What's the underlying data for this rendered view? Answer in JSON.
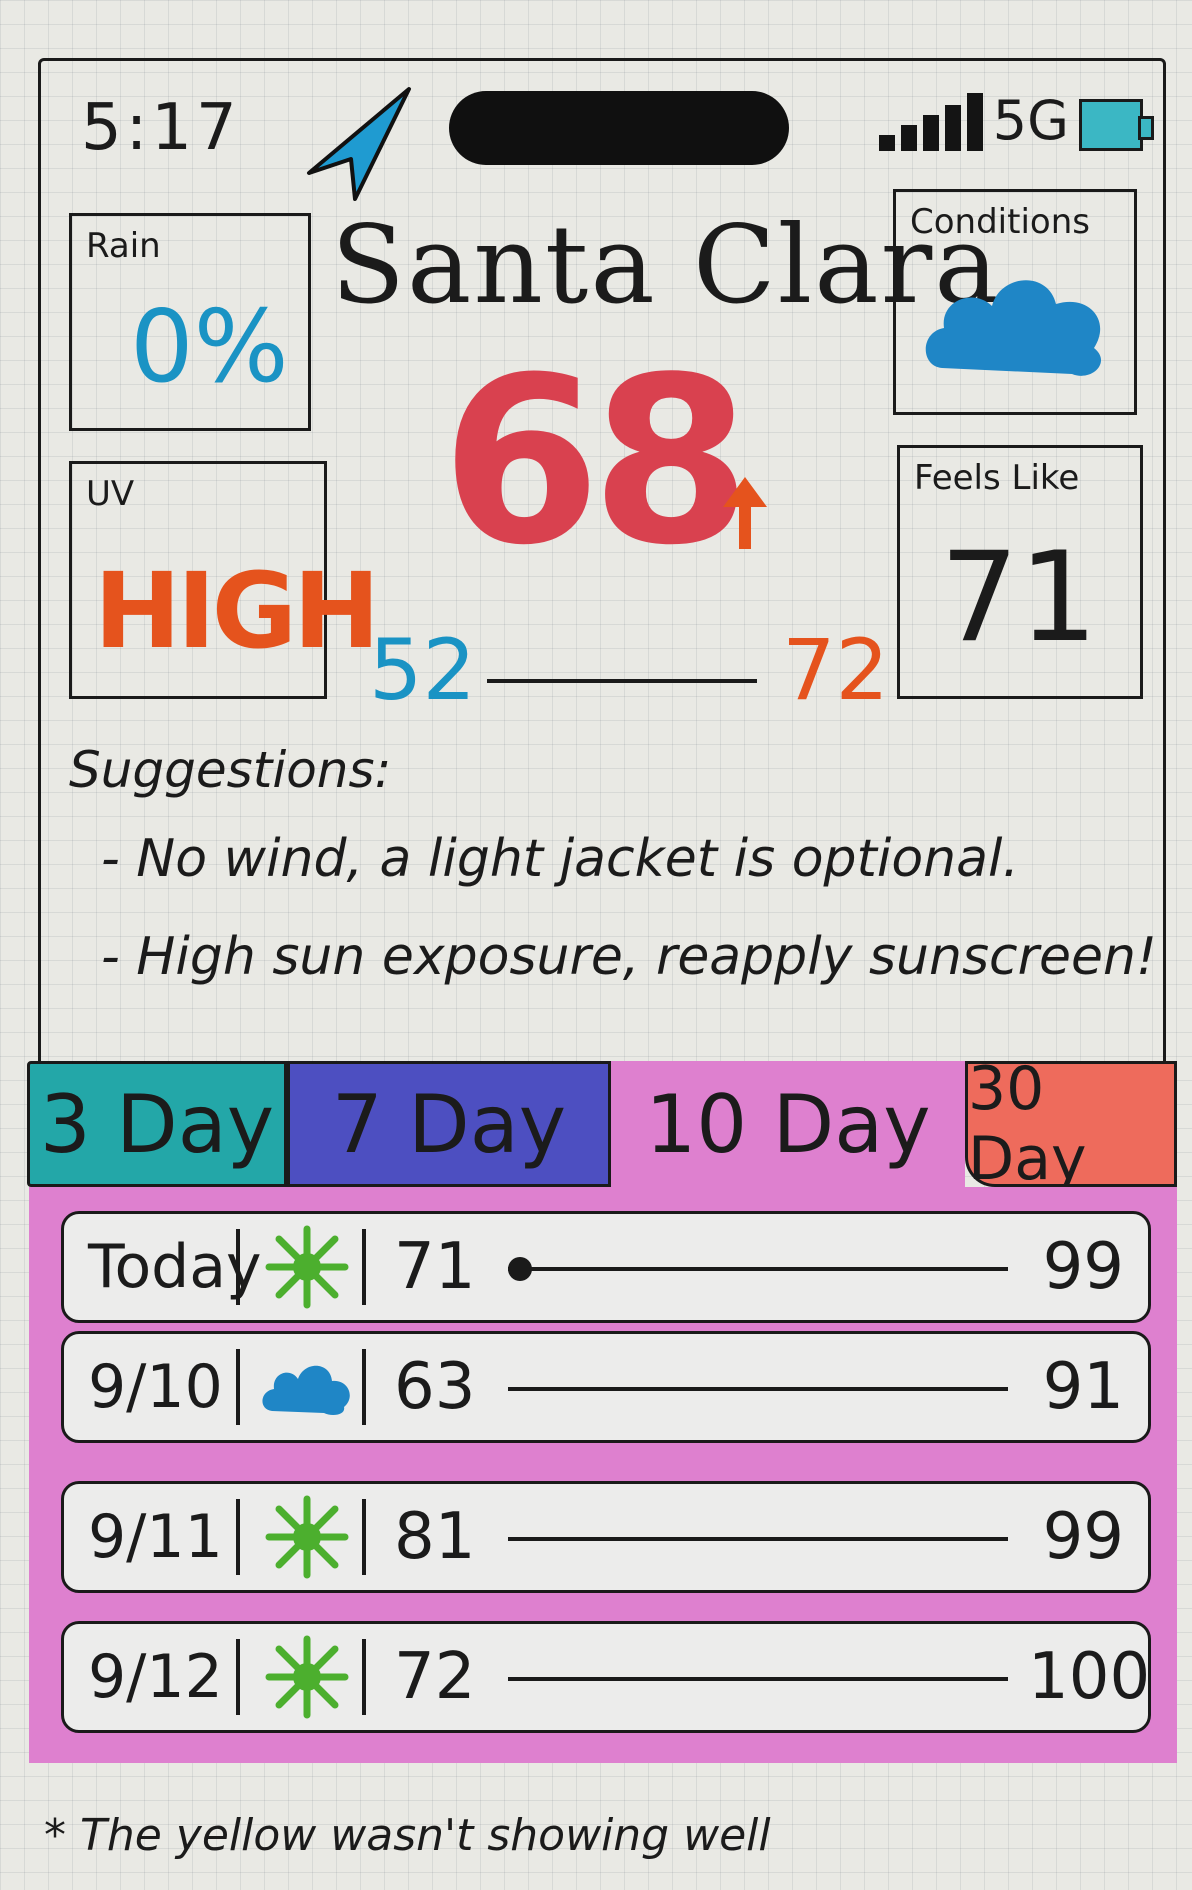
{
  "status_bar": {
    "time": "5:17",
    "network": "5G",
    "icons": [
      "location-arrow-icon",
      "signal-icon",
      "battery-icon"
    ]
  },
  "rain": {
    "label": "Rain",
    "value": "0%"
  },
  "uv": {
    "label": "UV",
    "value": "HIGH"
  },
  "conditions": {
    "label": "Conditions",
    "icon": "cloud-icon"
  },
  "feels_like": {
    "label": "Feels Like",
    "value": "71"
  },
  "location": {
    "city": "Santa Clara"
  },
  "current": {
    "temp": "68",
    "trend": "up-arrow-icon",
    "low": "52",
    "high": "72"
  },
  "suggestions": {
    "title": "Suggestions:",
    "items": [
      "- No wind, a light jacket is optional.",
      "- High sun exposure, reapply sunscreen!"
    ]
  },
  "tabs": [
    {
      "label": "3 Day"
    },
    {
      "label": "7 Day"
    },
    {
      "label": "10 Day"
    },
    {
      "label": "30 Day"
    }
  ],
  "forecast": [
    {
      "day": "Today",
      "icon": "sun-icon",
      "low": "71",
      "high": "99",
      "marker": true
    },
    {
      "day": "9/10",
      "icon": "cloud-icon",
      "low": "63",
      "high": "91",
      "marker": false
    },
    {
      "day": "9/11",
      "icon": "sun-icon",
      "low": "81",
      "high": "99",
      "marker": false
    },
    {
      "day": "9/12",
      "icon": "sun-icon",
      "low": "72",
      "high": "100",
      "marker": false
    }
  ],
  "footnote": "* The yellow wasn't showing well",
  "colors": {
    "rain": "#1a93c4",
    "uv": "#e5531d",
    "temp": "#d9414f",
    "cloud": "#1f86c6",
    "sun": "#4caf2e",
    "tab_3": "#23a7a8",
    "tab_7": "#4d4fc1",
    "tab_10": "#de80cf",
    "tab_30": "#ee6b5c"
  }
}
